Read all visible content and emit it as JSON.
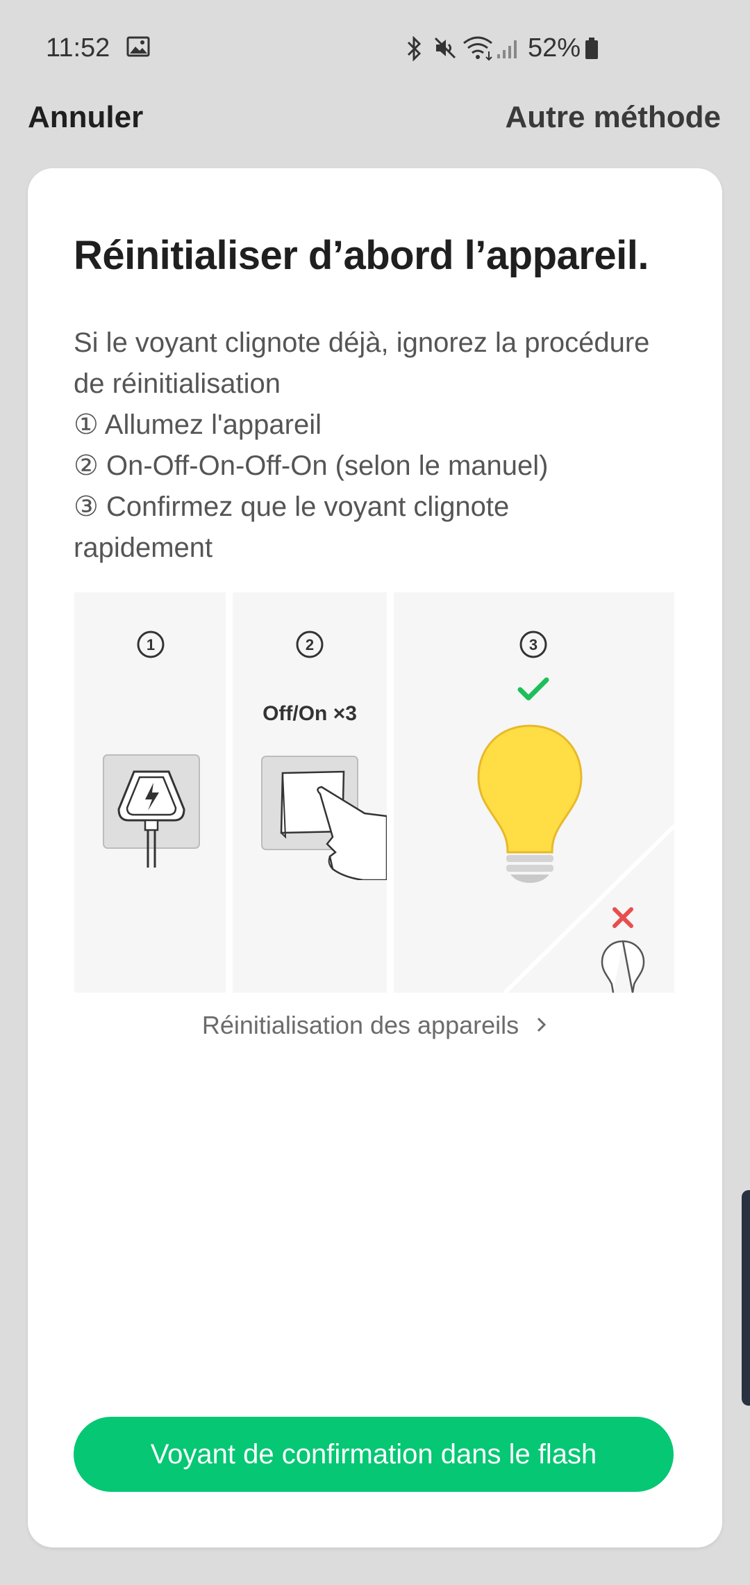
{
  "status_bar": {
    "time": "11:52",
    "battery": "52%",
    "icons": [
      "gallery-icon",
      "bluetooth-icon",
      "mute-icon",
      "wifi-icon",
      "signal-icon",
      "battery-icon"
    ]
  },
  "top_bar": {
    "cancel_label": "Annuler",
    "other_method_label": "Autre méthode"
  },
  "card": {
    "title": "Réinitialiser d’abord l’appareil.",
    "description_lines": [
      "Si le voyant clignote déjà, ignorez la procédure",
      "de réinitialisation",
      "① Allumez l'appareil",
      "② On-Off-On-Off-On (selon le manuel)",
      "③ Confirmez que le voyant clignote",
      "rapidement"
    ],
    "illustration": {
      "steps": [
        "1",
        "2",
        "3"
      ],
      "step2_label": "Off/On ×3",
      "icons": [
        "power-plug-icon",
        "light-switch-icon",
        "check-icon",
        "light-bulb-on-icon",
        "cross-icon",
        "light-bulb-off-icon"
      ]
    },
    "link_label": "Réinitialisation des appareils",
    "confirm_button_label": "Voyant de confirmation dans le flash"
  },
  "colors": {
    "background": "#dcdcdc",
    "card": "#ffffff",
    "accent_green": "#06c774",
    "check_green": "#1dbf5b",
    "error_red": "#e84e4e",
    "bulb_yellow": "#ffdd44"
  }
}
